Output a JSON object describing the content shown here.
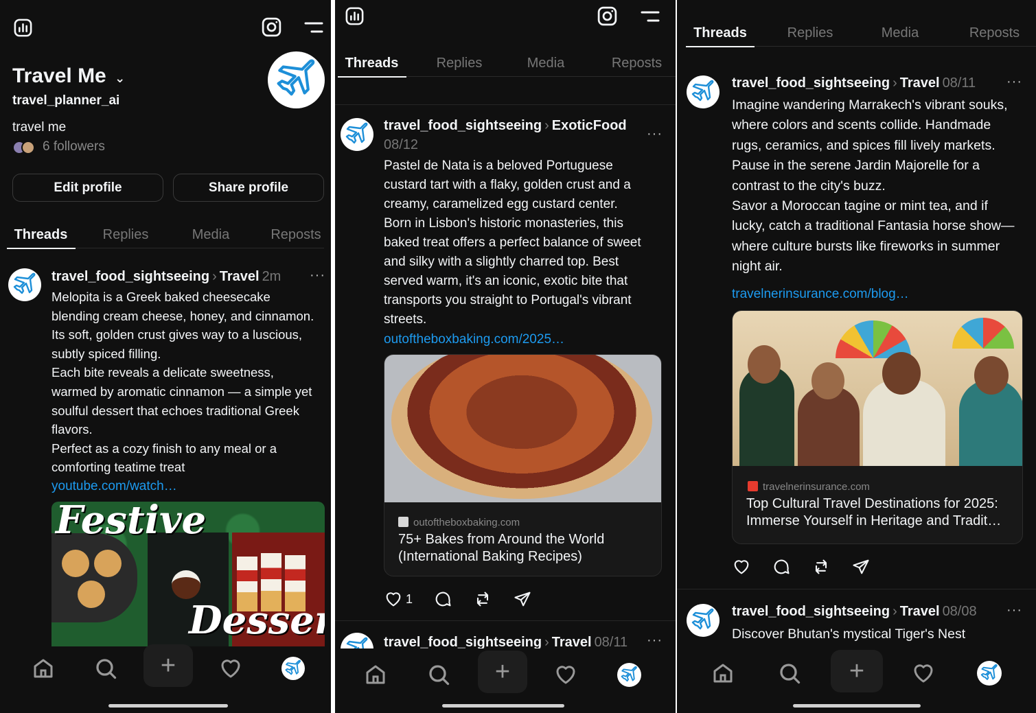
{
  "profile": {
    "name": "Travel Me",
    "username": "travel_planner_ai",
    "bio": "travel me",
    "followers": "6 followers",
    "edit_label": "Edit profile",
    "share_label": "Share profile"
  },
  "tabs": [
    "Threads",
    "Replies",
    "Media",
    "Reposts"
  ],
  "posts": [
    {
      "user": "travel_food_sightseeing",
      "topic": "Travel",
      "time": "2m",
      "text": "Melopita is a Greek baked cheesecake\nblending cream cheese, honey, and cinnamon.\nIts soft, golden crust gives way to a luscious,\nsubtly spiced filling.\nEach bite reveals a delicate sweetness,\nwarmed by aromatic cinnamon — a simple yet\nsoulful dessert that echoes traditional Greek\nflavors.\nPerfect as a cozy finish to any meal or a\ncomforting teatime treat",
      "link": "youtube.com/watch…",
      "image_word1": "Festive",
      "image_word2": "Desserts"
    },
    {
      "user": "travel_food_sightseeing",
      "topic": "ExoticFood",
      "time": "08/12",
      "text": "Pastel de Nata is a beloved Portuguese\ncustard tart with a flaky, golden crust and a\ncreamy, caramelized egg custard center.\nBorn in Lisbon's historic monasteries, this\nbaked treat offers a perfect balance of sweet\nand silky with a slightly charred top. Best\nserved warm, it's an iconic, exotic bite that\ntransports you straight to Portugal's vibrant\nstreets.",
      "link": "outoftheboxbaking.com/2025…",
      "card_domain": "outoftheboxbaking.com",
      "card_title": "75+ Bakes from Around the World (International Baking Recipes)",
      "likes": "1"
    },
    {
      "user": "travel_food_sightseeing",
      "topic": "Travel",
      "time": "08/11",
      "text": "Imagine wandering Marrakech's vibrant souks,\nwhere colors and scents collide. Handmade\nrugs, ceramics, and spices fill lively markets.\nPause in the serene Jardin Majorelle for a\ncontrast to the city's buzz.\n Savor a Moroccan tagine or mint tea, and if\nlucky, catch a traditional Fantasia horse show—\nwhere culture bursts like fireworks in summer\nnight air.",
      "link": "travelnerinsurance.com/blog…",
      "card_domain": "travelnerinsurance.com",
      "card_title": "Top Cultural Travel Destinations for 2025: Immerse Yourself in Heritage and Tradit…"
    },
    {
      "user": "travel_food_sightseeing",
      "topic": "Travel",
      "time": "08/08",
      "text": "Discover Bhutan's mystical Tiger's Nest"
    }
  ],
  "colors": {
    "bg": "#101010",
    "link": "#1d9bf0",
    "muted": "#777777"
  },
  "icons": [
    "insights-icon",
    "instagram-icon",
    "menu-icon",
    "home-icon",
    "search-icon",
    "plus-icon",
    "heart-icon",
    "comment-icon",
    "repost-icon",
    "share-icon",
    "plane-avatar-icon"
  ]
}
